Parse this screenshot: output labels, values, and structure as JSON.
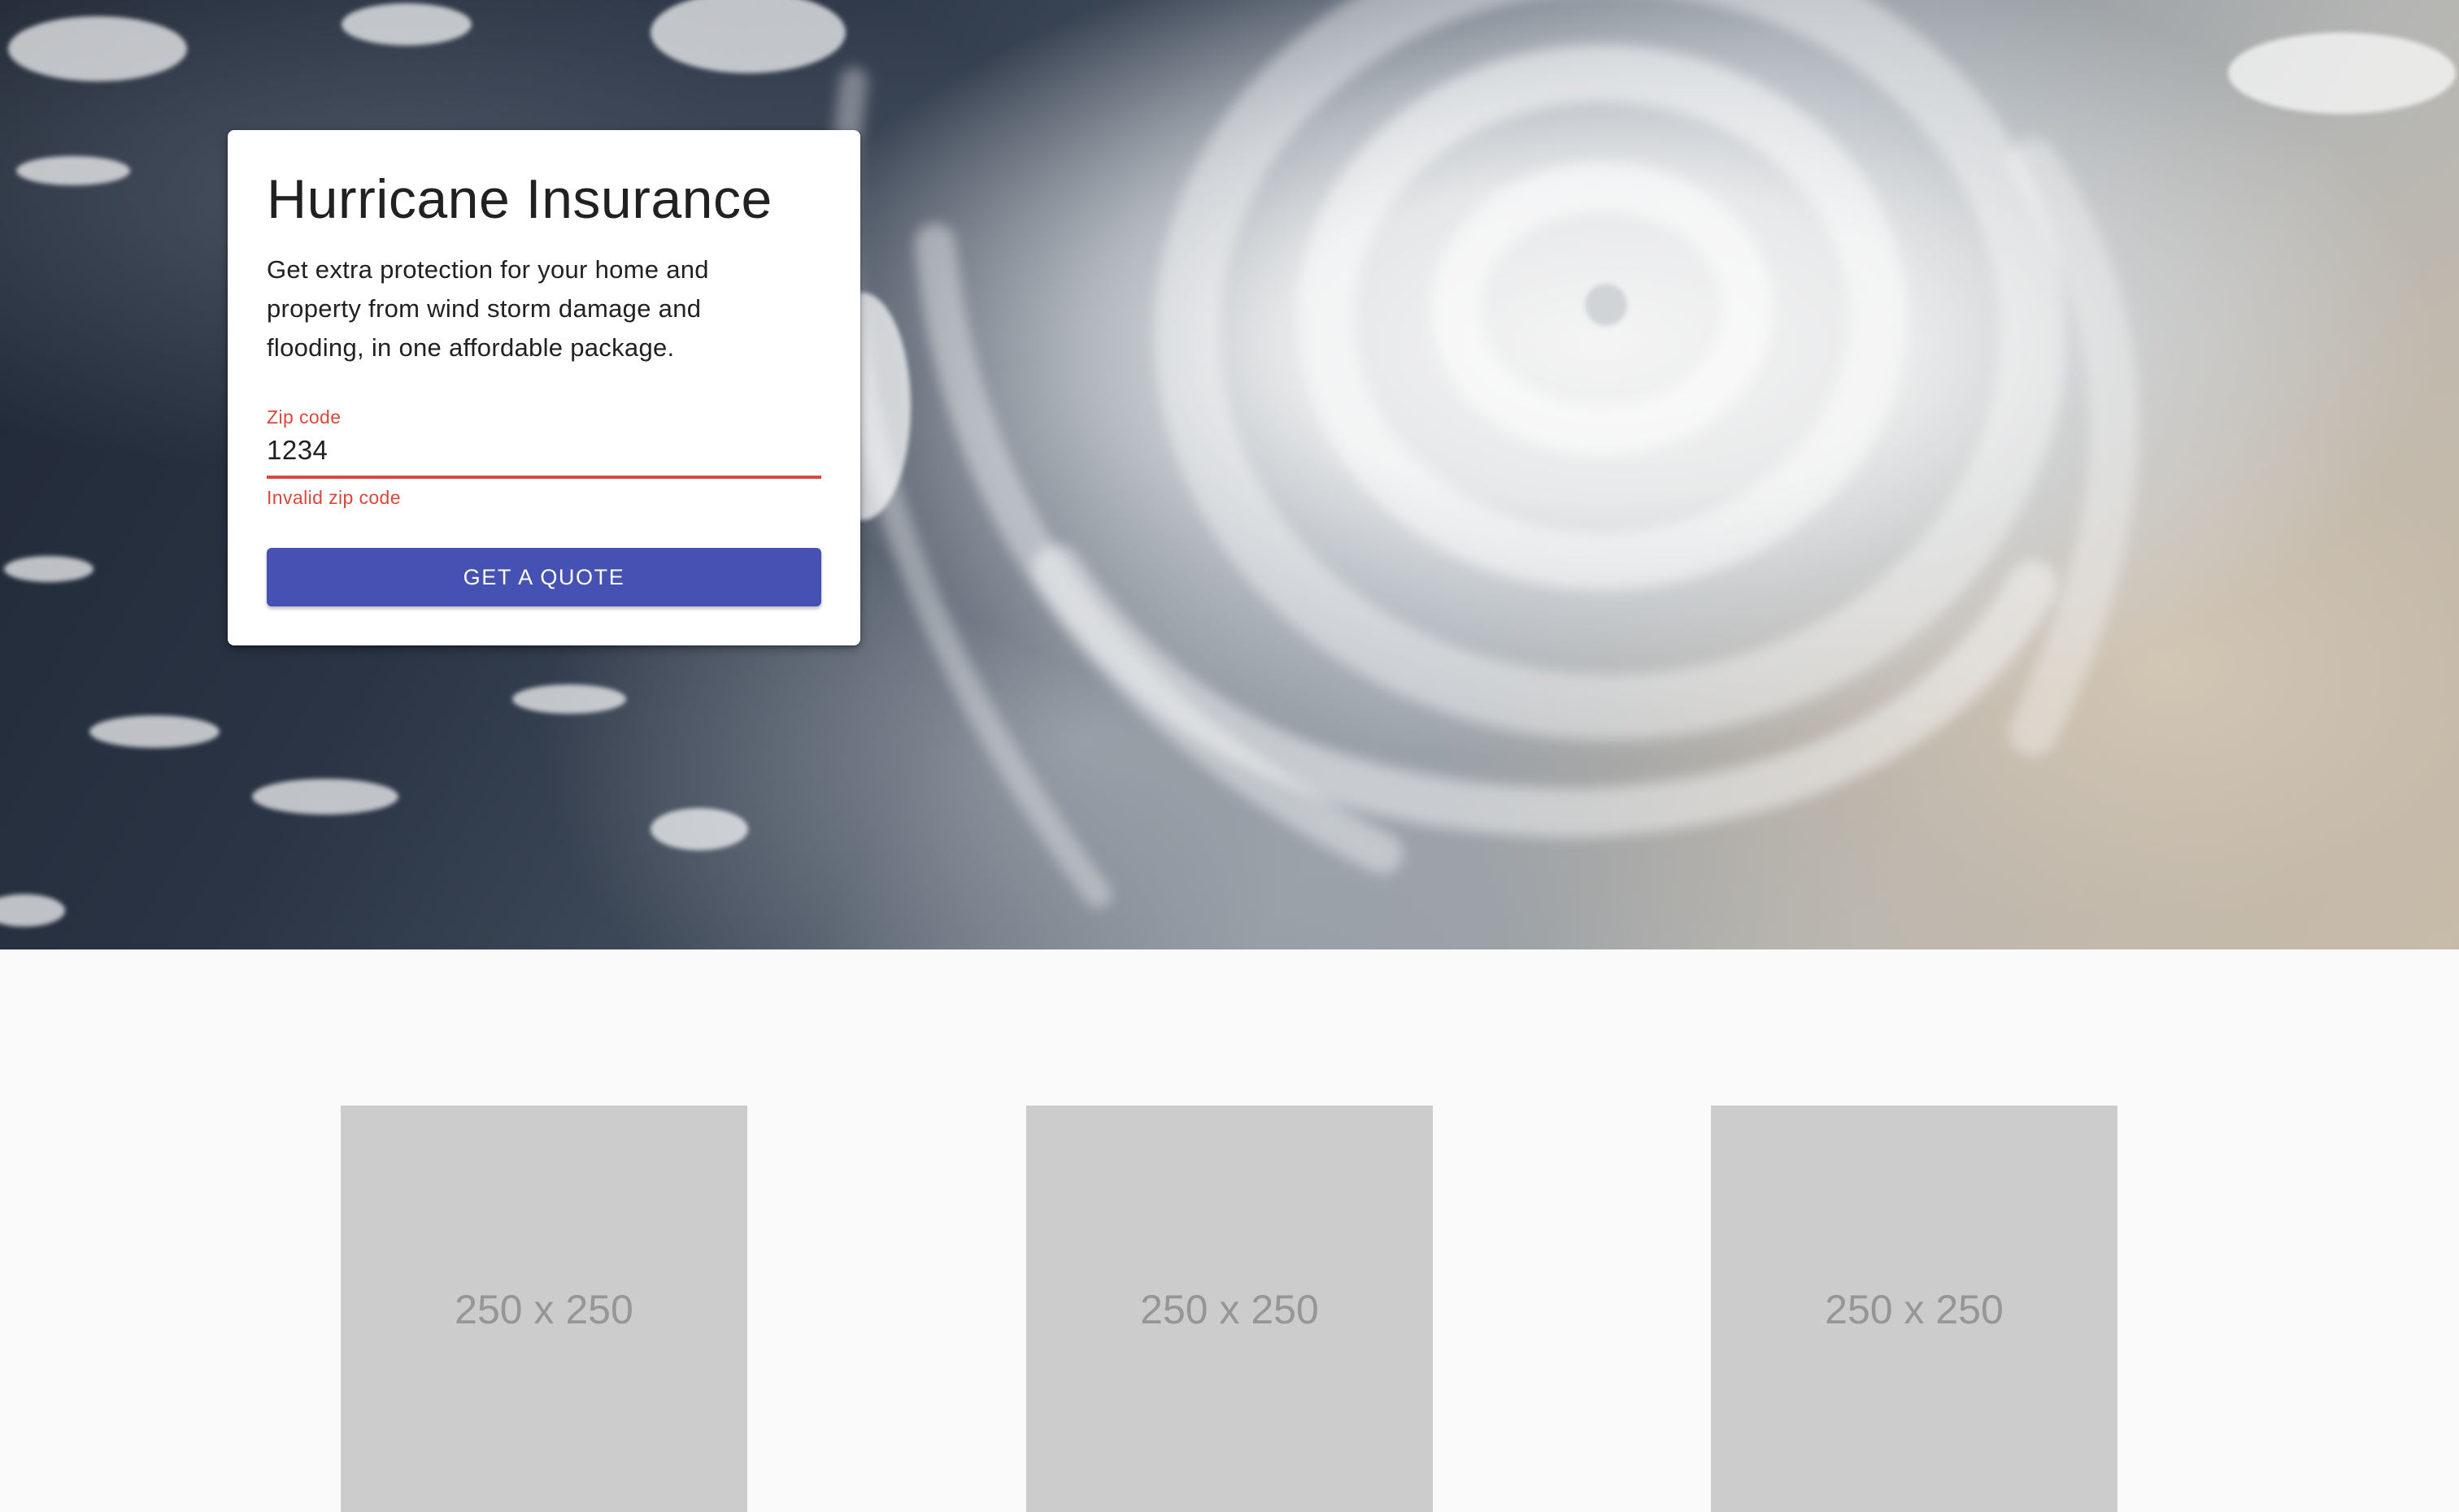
{
  "hero": {
    "card": {
      "title": "Hurricane Insurance",
      "description": "Get extra protection for your home and property from wind storm damage and flooding, in one affordable package.",
      "zip_field": {
        "label": "Zip code",
        "value": "1234",
        "error": "Invalid zip code"
      },
      "button_label": "GET A QUOTE"
    }
  },
  "placeholders": [
    {
      "label": "250 x 250"
    },
    {
      "label": "250 x 250"
    },
    {
      "label": "250 x 250"
    }
  ],
  "colors": {
    "primary": "#4552b3",
    "error": "#d9473d",
    "page_background": "#fafafa",
    "placeholder": "#cccccc"
  }
}
